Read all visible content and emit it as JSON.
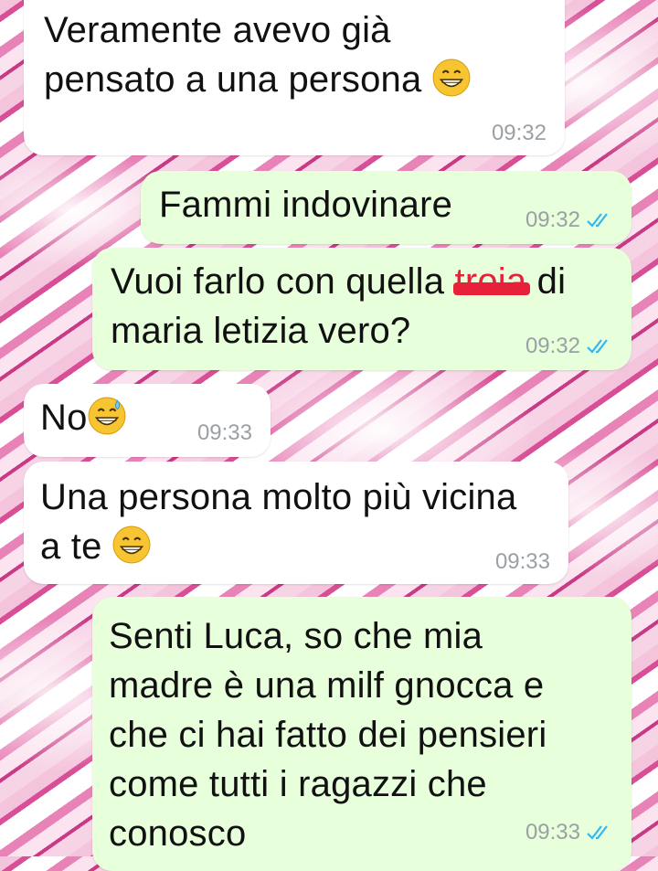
{
  "chat": {
    "messages": [
      {
        "direction": "in",
        "lines": [
          "Veramente avevo già",
          "pensato a una persona"
        ],
        "time": "09:32",
        "emoji": "grinning-face"
      },
      {
        "direction": "out",
        "lines": [
          "Fammi indovinare"
        ],
        "time": "09:32",
        "status": "read"
      },
      {
        "direction": "out",
        "lines_a": "Vuoi farlo con quella ",
        "censored_word": "troia",
        "lines_b": " di",
        "line2": "maria letizia vero?",
        "time": "09:32",
        "status": "read"
      },
      {
        "direction": "in",
        "lines": [
          "No"
        ],
        "time": "09:33",
        "emoji": "grinning-sweat-face"
      },
      {
        "direction": "in",
        "lines": [
          "Una persona molto più vicina",
          "a te"
        ],
        "time": "09:33",
        "emoji": "grinning-face"
      },
      {
        "direction": "out",
        "lines": [
          "Senti Luca, so che mia",
          "madre è una milf gnocca e",
          "che ci hai fatto dei pensieri",
          "come tutti i ragazzi che",
          "conosco"
        ],
        "time": "09:33",
        "status": "read"
      }
    ]
  },
  "colors": {
    "incoming_bubble": "#ffffff",
    "outgoing_bubble": "#e7ffdb",
    "timestamp": "#9aa0a4",
    "read_ticks": "#34b7f1",
    "censor_bar": "#e8213a"
  }
}
